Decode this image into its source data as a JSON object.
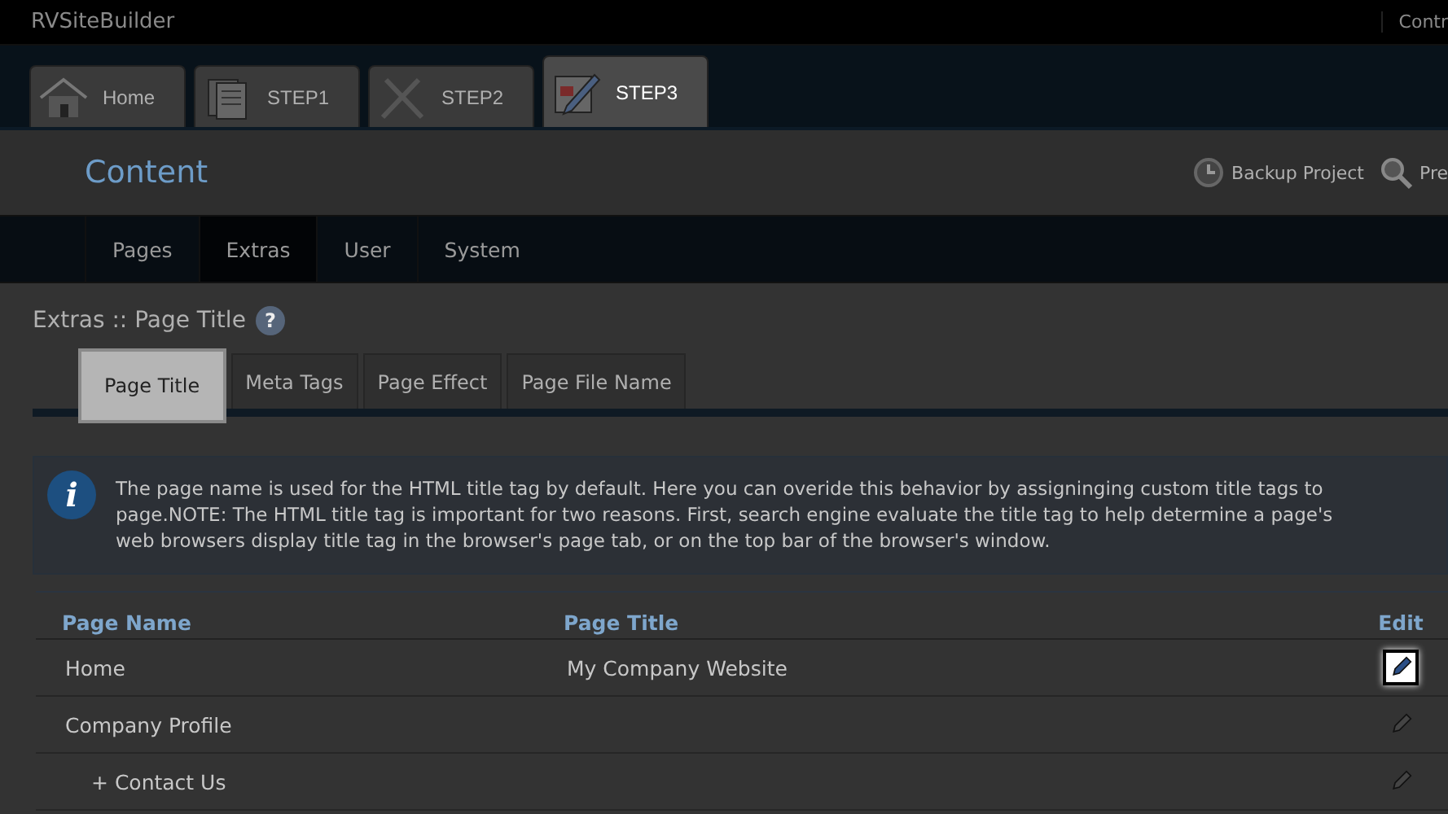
{
  "app": {
    "title": "RVSiteBuilder",
    "top_link": "Contr"
  },
  "steps": [
    {
      "label": "Home",
      "selected": false
    },
    {
      "label": "STEP1",
      "selected": false
    },
    {
      "label": "STEP2",
      "selected": false
    },
    {
      "label": "STEP3",
      "selected": true
    }
  ],
  "header": {
    "title": "Content",
    "actions": [
      {
        "label": "Backup Project"
      },
      {
        "label": "Pre"
      }
    ]
  },
  "menu": [
    {
      "label": "Pages",
      "selected": false
    },
    {
      "label": "Extras",
      "selected": true
    },
    {
      "label": "User",
      "selected": false
    },
    {
      "label": "System",
      "selected": false
    }
  ],
  "breadcrumb": "Extras :: Page Title",
  "help_mark": "?",
  "subtabs": [
    {
      "label": "Page Title",
      "selected": true
    },
    {
      "label": "Meta Tags",
      "selected": false
    },
    {
      "label": "Page Effect",
      "selected": false
    },
    {
      "label": "Page File Name",
      "selected": false
    }
  ],
  "info": {
    "mark": "i",
    "lines": [
      "The page name is used for the HTML title tag by default. Here you can overide this behavior by assigninging custom title tags to",
      "page.NOTE: The HTML title tag is important for two reasons. First, search engine evaluate the title tag to help determine a page's",
      "web browsers display title tag in the browser's page tab, or on the top bar of the browser's window."
    ]
  },
  "table": {
    "columns": [
      "Page Name",
      "Page Title",
      "Edit"
    ],
    "rows": [
      {
        "name": "Home",
        "title": "My Company Website",
        "highlighted": true
      },
      {
        "name": "Company Profile",
        "highlighted": false,
        "children": [
          {
            "name": "+ Contact Us",
            "highlighted": false
          }
        ]
      }
    ]
  }
}
